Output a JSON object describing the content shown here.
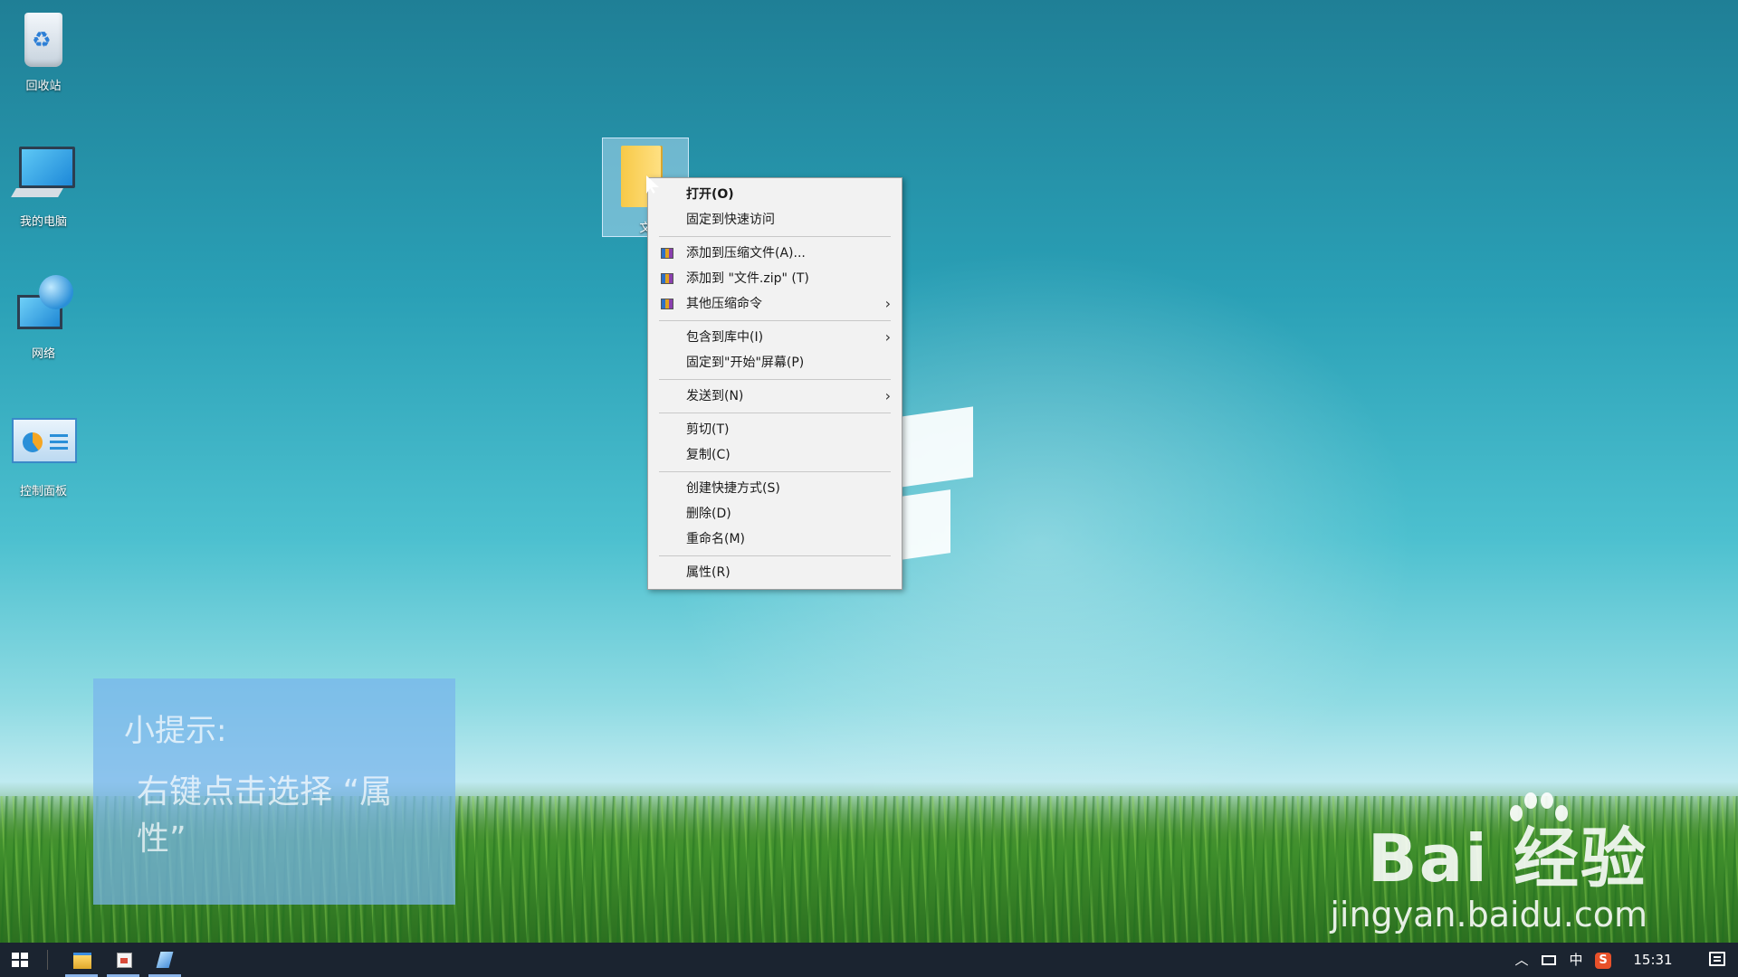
{
  "desktop": {
    "icons": [
      {
        "label": "回收站",
        "icon": "recycle-bin-icon"
      },
      {
        "label": "我的电脑",
        "icon": "computer-icon"
      },
      {
        "label": "网络",
        "icon": "network-icon"
      },
      {
        "label": "控制面板",
        "icon": "control-panel-icon"
      }
    ],
    "selected_folder": {
      "label": "文",
      "icon": "folder-icon"
    }
  },
  "context_menu": {
    "items": [
      {
        "label": "打开(O)",
        "bold": true
      },
      {
        "label": "固定到快速访问"
      },
      {
        "label": "添加到压缩文件(A)...",
        "icon": "winrar-icon"
      },
      {
        "label": "添加到 \"文件.zip\" (T)",
        "icon": "winrar-icon"
      },
      {
        "label": "其他压缩命令",
        "icon": "winrar-icon",
        "submenu": true
      },
      {
        "label": "包含到库中(I)",
        "submenu": true
      },
      {
        "label": "固定到\"开始\"屏幕(P)"
      },
      {
        "label": "发送到(N)",
        "submenu": true
      },
      {
        "label": "剪切(T)"
      },
      {
        "label": "复制(C)"
      },
      {
        "label": "创建快捷方式(S)"
      },
      {
        "label": "删除(D)"
      },
      {
        "label": "重命名(M)"
      },
      {
        "label": "属性(R)"
      }
    ],
    "submenu_arrow": "›"
  },
  "tip": {
    "title": "小提示:",
    "text": "右键点击选择 “属性”"
  },
  "watermark": {
    "brand": "Bai  经验",
    "url": "jingyan.baidu.com"
  },
  "taskbar": {
    "apps": [
      {
        "name": "file-explorer-icon"
      },
      {
        "name": "app-icon"
      },
      {
        "name": "app-icon"
      }
    ],
    "tray": {
      "chevron": "︿",
      "ime": "中",
      "sogou": "S",
      "time": "15:31"
    }
  },
  "colors": {
    "menu_bg": "#f2f2f2",
    "taskbar_bg": "#1b2430",
    "tip_bg": "#78b4eb"
  }
}
